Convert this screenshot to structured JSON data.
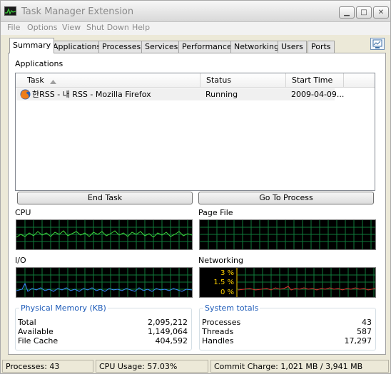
{
  "window": {
    "title": "Task Manager Extension",
    "minimize_glyph": "▁",
    "maximize_glyph": "□",
    "close_glyph": "✕"
  },
  "menu": [
    "File",
    "Options",
    "View",
    "Shut Down",
    "Help"
  ],
  "tabs": [
    "Summary",
    "Applications",
    "Processes",
    "Services",
    "Performance",
    "Networking",
    "Users",
    "Ports"
  ],
  "active_tab": "Summary",
  "applications": {
    "label": "Applications",
    "columns": {
      "task": "Task",
      "status": "Status",
      "start_time": "Start Time"
    },
    "rows": [
      {
        "task": "한RSS - 내 RSS - Mozilla Firefox",
        "status": "Running",
        "start_time": "2009-04-09...",
        "icon": "firefox-icon"
      }
    ]
  },
  "buttons": {
    "end_task": "End Task",
    "go_to_process": "Go To Process"
  },
  "graphs": {
    "cpu_label": "CPU",
    "pagefile_label": "Page File",
    "io_label": "I/O",
    "networking_label": "Networking",
    "networking_scale": [
      "3 %",
      "1.5 %",
      "0 %"
    ],
    "colors": {
      "cpu": "#3cd23c",
      "io": "#3a8cff",
      "network": "#e03030",
      "grid": "#0f7a3a",
      "scale": "#ffd200"
    }
  },
  "physical_memory": {
    "title": "Physical Memory (KB)",
    "items": [
      {
        "name": "Total",
        "value": "2,095,212"
      },
      {
        "name": "Available",
        "value": "1,149,064"
      },
      {
        "name": "File Cache",
        "value": "404,592"
      }
    ]
  },
  "system_totals": {
    "title": "System totals",
    "items": [
      {
        "name": "Processes",
        "value": "43"
      },
      {
        "name": "Threads",
        "value": "587"
      },
      {
        "name": "Handles",
        "value": "17,297"
      }
    ]
  },
  "status_bar": {
    "processes": "Processes: 43",
    "cpu_usage": "CPU Usage: 57.03%",
    "commit_charge": "Commit Charge: 1,021 MB / 3,941 MB"
  },
  "accent_color": "#1c5ab8"
}
